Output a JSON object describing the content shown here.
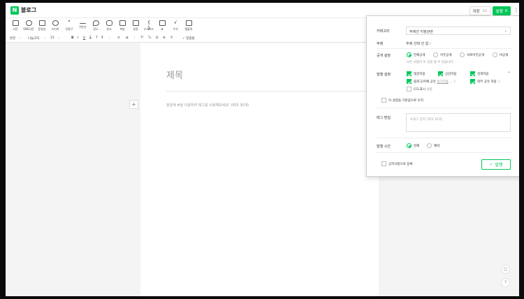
{
  "header": {
    "logo_letter": "N",
    "brand": "블로그",
    "save_label": "저장",
    "save_count": "11",
    "publish_label": "발행",
    "publish_count": "0",
    "more_icon": "more-vertical-icon"
  },
  "toolbar": {
    "items": [
      {
        "label": "사진",
        "icon": "photo-icon"
      },
      {
        "label": "SNS사진",
        "icon": "sns-photo-icon"
      },
      {
        "label": "동영상",
        "icon": "video-icon"
      },
      {
        "label": "스티커",
        "icon": "sticker-icon"
      },
      {
        "label": "인용구",
        "icon": "quote-icon"
      },
      {
        "label": "구분선",
        "icon": "divider-icon"
      },
      {
        "label": "장소",
        "icon": "place-icon"
      },
      {
        "label": "링크",
        "icon": "link-icon"
      },
      {
        "label": "파일",
        "icon": "file-icon"
      },
      {
        "label": "일정",
        "icon": "calendar-icon"
      },
      {
        "label": "소스코드",
        "icon": "code-icon"
      },
      {
        "label": "표",
        "icon": "table-icon"
      },
      {
        "label": "수식",
        "icon": "formula-icon"
      },
      {
        "label": "템플릿",
        "icon": "template-icon"
      }
    ]
  },
  "formatbar": {
    "style": "본문",
    "font": "나눔고딕",
    "size": "15",
    "spellcheck": "맞춤법"
  },
  "editor": {
    "title_placeholder": "제목",
    "body_placeholder": "본문에 #을 이용하여 태그를 사용해보세요! (최대 30개)",
    "add_symbol": "+"
  },
  "panel": {
    "category_label": "카테고리",
    "category_value": "주제선 지정관련",
    "topic_label": "주제",
    "topic_value": "주제 선택 안 함",
    "visibility_label": "공개 설정",
    "visibility_options": [
      "전체공개",
      "이웃공개",
      "서로이웃공개",
      "비공개"
    ],
    "visibility_note": "모든 사람이 이 글을 볼 수 있습니다",
    "publish_settings_label": "발행 설정",
    "settings_options": [
      "댓글허용",
      "공감허용",
      "검색허용",
      "블로그/카페 공유",
      "외부 공유 허용",
      "CCL표시"
    ],
    "share_link": "링크허용",
    "ccl_sub": "설정",
    "notice_label": "이 설정을 기본값으로 유지",
    "tag_label": "태그 편집",
    "tag_placeholder": "#태그 입력 (최대 30개)",
    "time_label": "발행 시간",
    "time_options": [
      "현재",
      "예약"
    ],
    "notice_register": "공지사항으로 등록",
    "final_publish": "발행"
  },
  "colors": {
    "accent": "#03c75a"
  }
}
